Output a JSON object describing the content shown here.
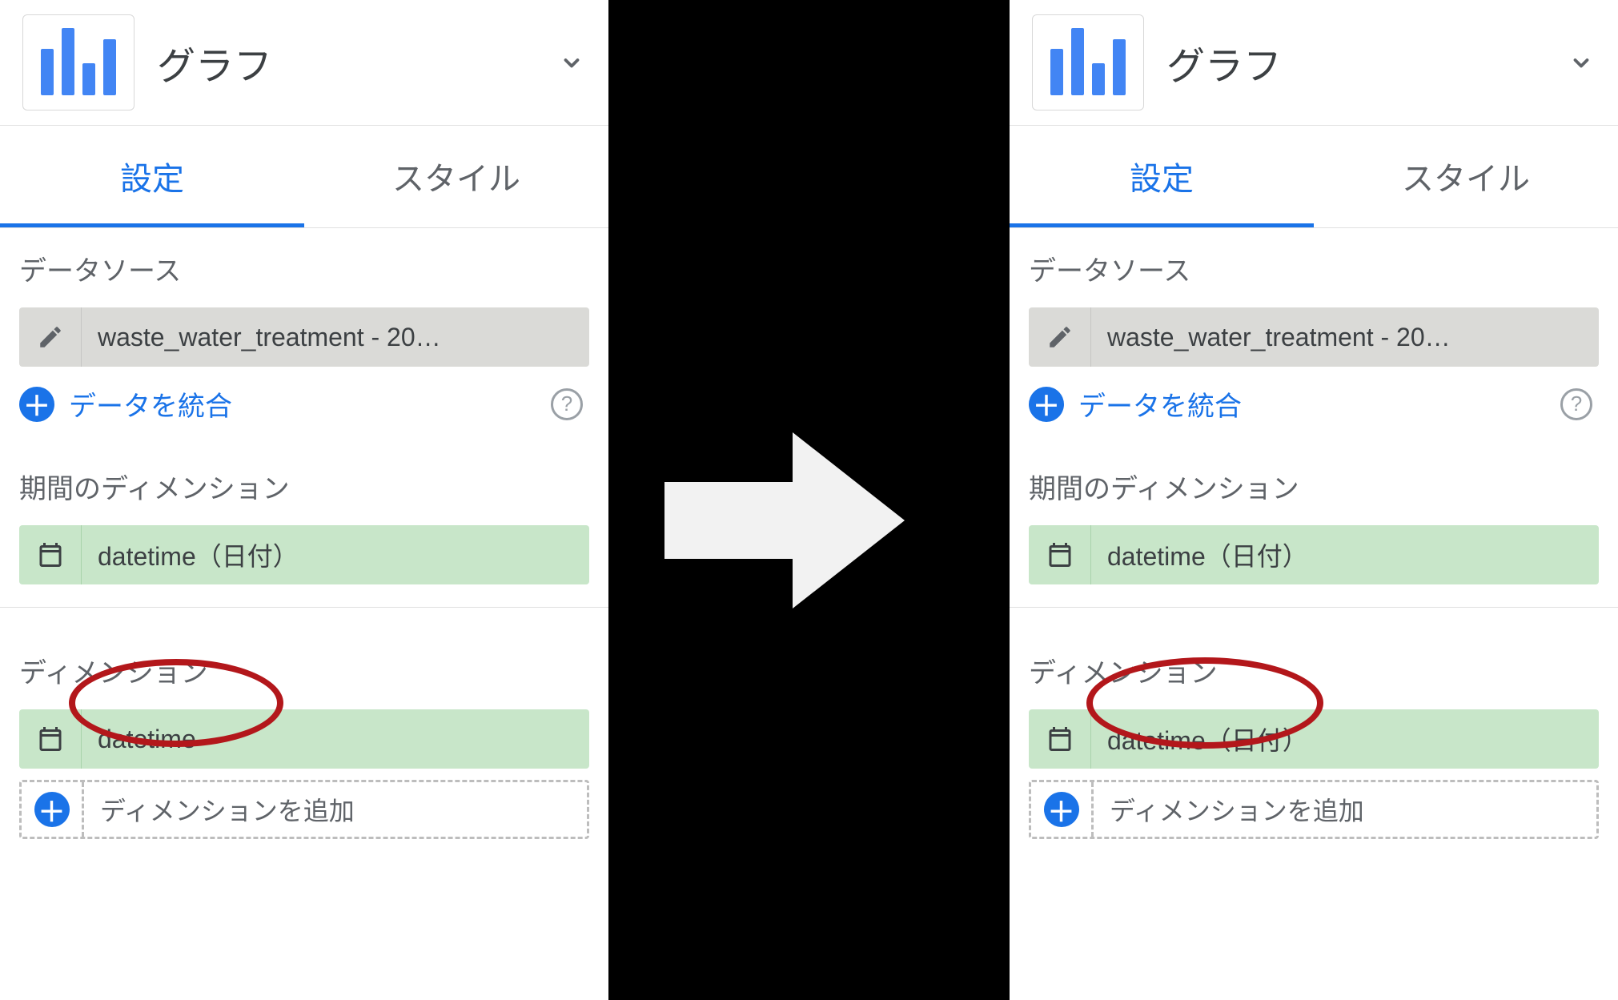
{
  "left": {
    "header": {
      "title": "グラフ"
    },
    "tabs": {
      "settings": "設定",
      "style": "スタイル"
    },
    "datasource": {
      "label": "データソース",
      "name": "waste_water_treatment - 20…",
      "merge_link": "データを統合"
    },
    "date_dimension": {
      "label": "期間のディメンション",
      "field": "datetime（日付）"
    },
    "dimension": {
      "label": "ディメンション",
      "field": "datetime",
      "add": "ディメンションを追加"
    }
  },
  "right": {
    "header": {
      "title": "グラフ"
    },
    "tabs": {
      "settings": "設定",
      "style": "スタイル"
    },
    "datasource": {
      "label": "データソース",
      "name": "waste_water_treatment - 20…",
      "merge_link": "データを統合"
    },
    "date_dimension": {
      "label": "期間のディメンション",
      "field": "datetime（日付）"
    },
    "dimension": {
      "label": "ディメンション",
      "field": "datetime（日付）",
      "add": "ディメンションを追加"
    }
  }
}
